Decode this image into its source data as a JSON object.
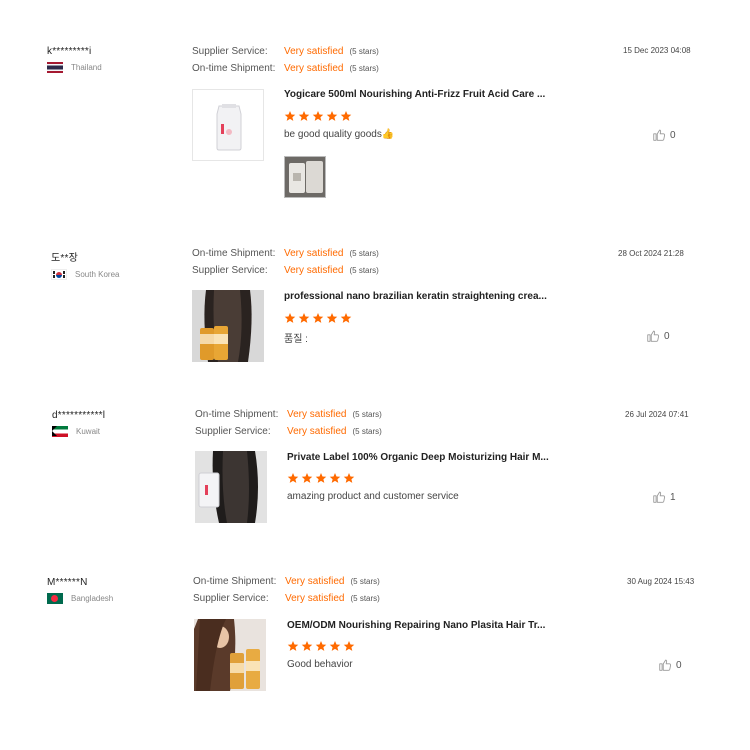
{
  "reviews": [
    {
      "reviewer": "k*********i",
      "country": "Thailand",
      "rating_1_label": "Supplier Service:",
      "rating_1_value": "Very satisfied",
      "rating_1_stars": "(5 stars)",
      "rating_2_label": "On-time Shipment:",
      "rating_2_value": "Very satisfied",
      "rating_2_stars": "(5 stars)",
      "date": "15 Dec 2023 04:08",
      "product_title": "Yogicare 500ml Nourishing Anti-Frizz Fruit Acid Care ...",
      "product_rating": 5,
      "text": "be good quality goods👍",
      "helpful_count": "0"
    },
    {
      "reviewer": "도**장",
      "country": "South Korea",
      "rating_1_label": "On-time Shipment:",
      "rating_1_value": "Very satisfied",
      "rating_1_stars": "(5 stars)",
      "rating_2_label": "Supplier Service:",
      "rating_2_value": "Very satisfied",
      "rating_2_stars": "(5 stars)",
      "date": "28 Oct 2024 21:28",
      "product_title": "professional nano brazilian keratin straightening crea...",
      "product_rating": 5,
      "text": "품질 :",
      "helpful_count": "0"
    },
    {
      "reviewer": "d***********l",
      "country": "Kuwait",
      "rating_1_label": "On-time Shipment:",
      "rating_1_value": "Very satisfied",
      "rating_1_stars": "(5 stars)",
      "rating_2_label": "Supplier Service:",
      "rating_2_value": "Very satisfied",
      "rating_2_stars": "(5 stars)",
      "date": "26 Jul 2024 07:41",
      "product_title": "Private Label 100% Organic Deep Moisturizing Hair M...",
      "product_rating": 5,
      "text": "amazing product and customer service",
      "helpful_count": "1"
    },
    {
      "reviewer": "M******N",
      "country": "Bangladesh",
      "rating_1_label": "On-time Shipment:",
      "rating_1_value": "Very satisfied",
      "rating_1_stars": "(5 stars)",
      "rating_2_label": "Supplier Service:",
      "rating_2_value": "Very satisfied",
      "rating_2_stars": "(5 stars)",
      "date": "30 Aug 2024 15:43",
      "product_title": "OEM/ODM Nourishing Repairing Nano Plasita Hair Tr...",
      "product_rating": 5,
      "text": "Good behavior",
      "helpful_count": "0"
    }
  ],
  "colors": {
    "accent": "#ff6a00",
    "text_muted": "#888888"
  },
  "icons": {
    "helpful": "thumbs-up-icon",
    "rating": "star-icon"
  }
}
